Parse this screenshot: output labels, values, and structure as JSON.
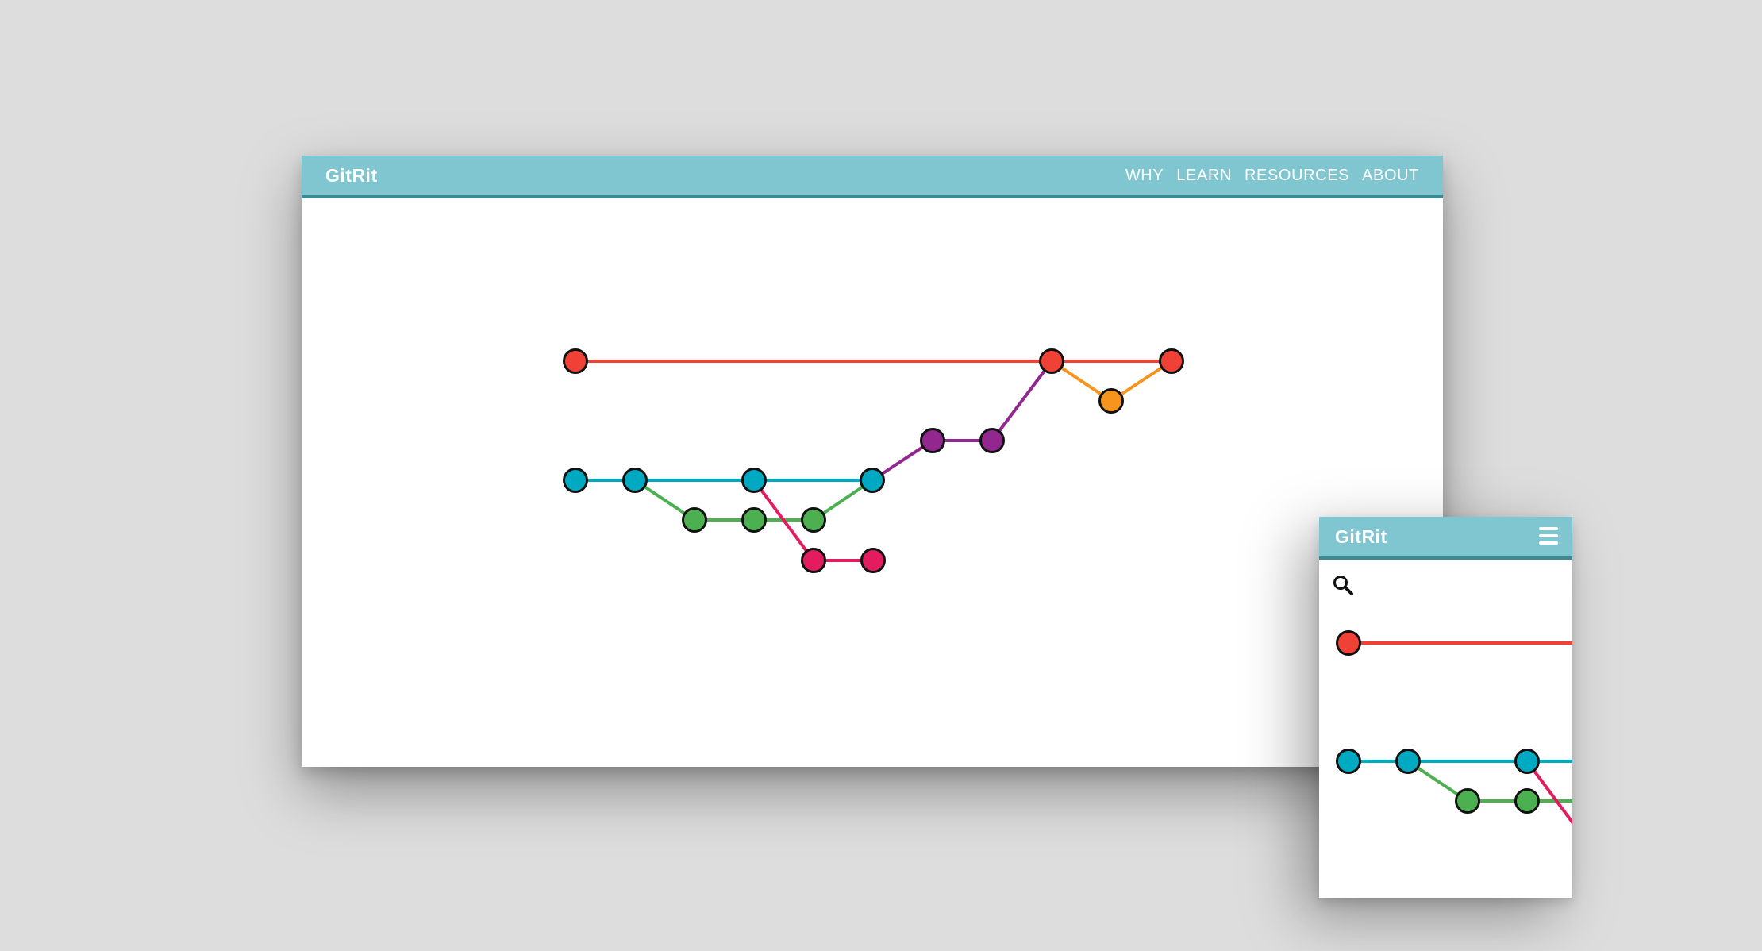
{
  "desktop": {
    "brand": "GitRit",
    "nav": [
      {
        "label": "WHY"
      },
      {
        "label": "LEARN"
      },
      {
        "label": "RESOURCES"
      },
      {
        "label": "ABOUT"
      }
    ]
  },
  "mobile": {
    "brand": "GitRit",
    "menu_icon": "hamburger-menu-icon",
    "search_icon": "search-icon"
  },
  "colors": {
    "navbar": "#7fc6d0",
    "navbar_border": "#3d8a92",
    "background": "#dddddd",
    "red": "#ef4136",
    "orange": "#f7941d",
    "purple": "#92278f",
    "teal": "#00a9c2",
    "green": "#4caf50",
    "pink": "#e31b5f"
  }
}
